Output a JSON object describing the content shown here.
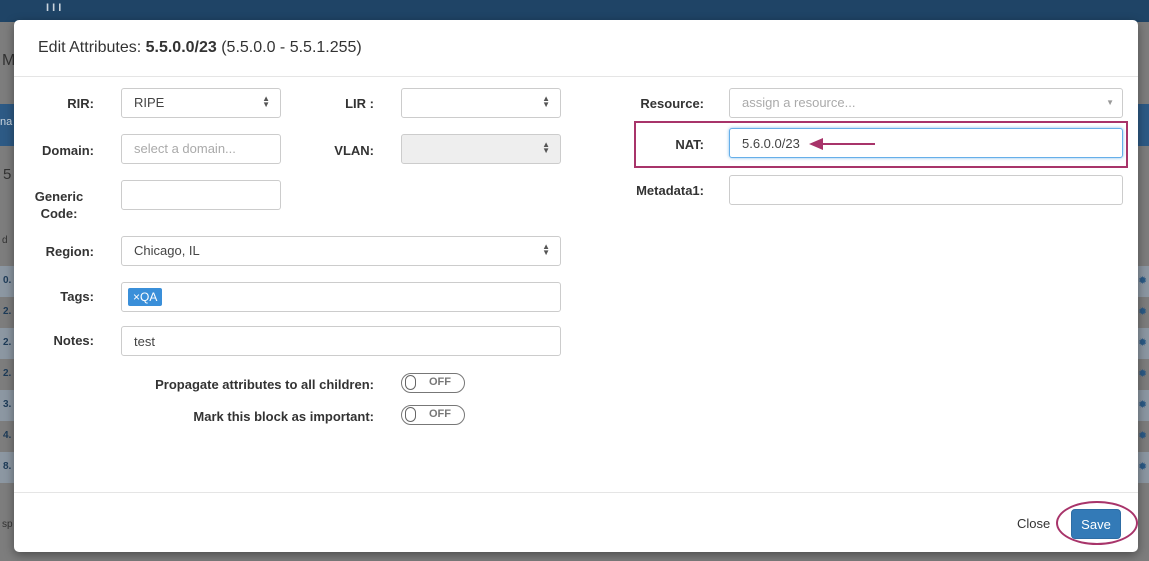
{
  "background": {
    "top_text": "I I I",
    "left_letters": [
      "M",
      "na",
      "5",
      "d"
    ],
    "row_numbers": [
      "0.",
      "2.",
      "2.",
      "2.",
      "3.",
      "4.",
      "8."
    ],
    "bottom_text": "sp"
  },
  "modal": {
    "title_prefix": "Edit Attributes: ",
    "title_block": "5.5.0.0/23",
    "title_range": " (5.5.0.0 - 5.5.1.255)"
  },
  "form": {
    "rir": {
      "label": "RIR:",
      "value": "RIPE"
    },
    "lir": {
      "label": "LIR :",
      "value": ""
    },
    "domain": {
      "label": "Domain:",
      "placeholder": "select a domain..."
    },
    "vlan": {
      "label": "VLAN:",
      "value": ""
    },
    "generic_code": {
      "label_line1": "Generic",
      "label_line2": "Code:",
      "value": ""
    },
    "region": {
      "label": "Region:",
      "value": "Chicago, IL"
    },
    "tags": {
      "label": "Tags:",
      "items": [
        "×QA"
      ]
    },
    "notes": {
      "label": "Notes:",
      "value": "test"
    },
    "propagate": {
      "label": "Propagate attributes to all children:",
      "state": "OFF"
    },
    "important": {
      "label": "Mark this block as important:",
      "state": "OFF"
    },
    "resource": {
      "label": "Resource:",
      "placeholder": "assign a resource..."
    },
    "nat": {
      "label": "NAT:",
      "value": "5.6.0.0/23"
    },
    "metadata1": {
      "label": "Metadata1:",
      "value": ""
    }
  },
  "footer": {
    "close_label": "Close",
    "save_label": "Save"
  },
  "colors": {
    "accent": "#337ab7",
    "annotation": "#a8346a",
    "tag": "#3a8fd9"
  },
  "icons": {
    "select_arrows": "updown-arrows-icon",
    "dropdown": "caret-down-icon",
    "annotation_arrow": "arrow-left-icon"
  }
}
